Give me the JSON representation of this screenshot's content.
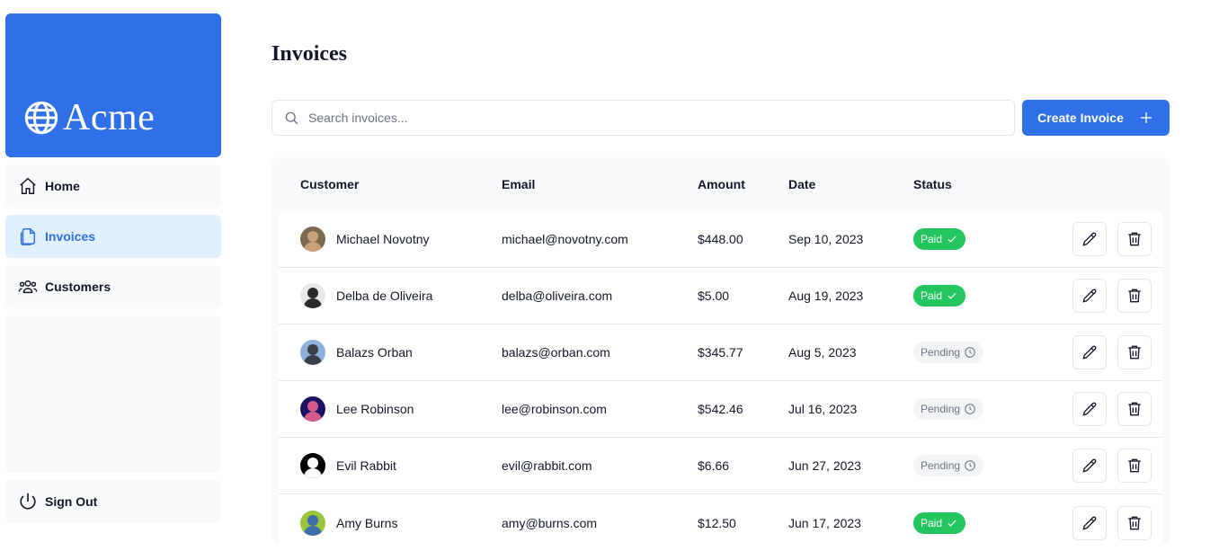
{
  "brand": {
    "name": "Acme",
    "accent": "#2f6fe8"
  },
  "nav": {
    "items": [
      {
        "label": "Home",
        "icon": "home-icon",
        "active": false
      },
      {
        "label": "Invoices",
        "icon": "document-icon",
        "active": true
      },
      {
        "label": "Customers",
        "icon": "users-icon",
        "active": false
      }
    ],
    "signout_label": "Sign Out"
  },
  "page": {
    "title": "Invoices"
  },
  "search": {
    "placeholder": "Search invoices..."
  },
  "create_button": {
    "label": "Create Invoice"
  },
  "table": {
    "headers": [
      "Customer",
      "Email",
      "Amount",
      "Date",
      "Status"
    ],
    "rows": [
      {
        "customer": "Michael Novotny",
        "email": "michael@novotny.com",
        "amount": "$448.00",
        "date": "Sep 10, 2023",
        "status": "Paid",
        "avatar_colors": [
          "#7a6a4e",
          "#c9a27a"
        ]
      },
      {
        "customer": "Delba de Oliveira",
        "email": "delba@oliveira.com",
        "amount": "$5.00",
        "date": "Aug 19, 2023",
        "status": "Paid",
        "avatar_colors": [
          "#e8e8e8",
          "#2a2a2a"
        ]
      },
      {
        "customer": "Balazs Orban",
        "email": "balazs@orban.com",
        "amount": "$345.77",
        "date": "Aug 5, 2023",
        "status": "Pending",
        "avatar_colors": [
          "#8fb0d8",
          "#3b3f48"
        ]
      },
      {
        "customer": "Lee Robinson",
        "email": "lee@robinson.com",
        "amount": "$542.46",
        "date": "Jul 16, 2023",
        "status": "Pending",
        "avatar_colors": [
          "#1b1464",
          "#d65a8a"
        ]
      },
      {
        "customer": "Evil Rabbit",
        "email": "evil@rabbit.com",
        "amount": "$6.66",
        "date": "Jun 27, 2023",
        "status": "Pending",
        "avatar_colors": [
          "#000000",
          "#ffffff"
        ]
      },
      {
        "customer": "Amy Burns",
        "email": "amy@burns.com",
        "amount": "$12.50",
        "date": "Jun 17, 2023",
        "status": "Paid",
        "avatar_colors": [
          "#9bc53d",
          "#3c6ea8"
        ]
      }
    ]
  },
  "colors": {
    "paid": "#22c55e",
    "pending_bg": "#f3f4f6",
    "active_nav_bg": "#e0f0fe"
  }
}
